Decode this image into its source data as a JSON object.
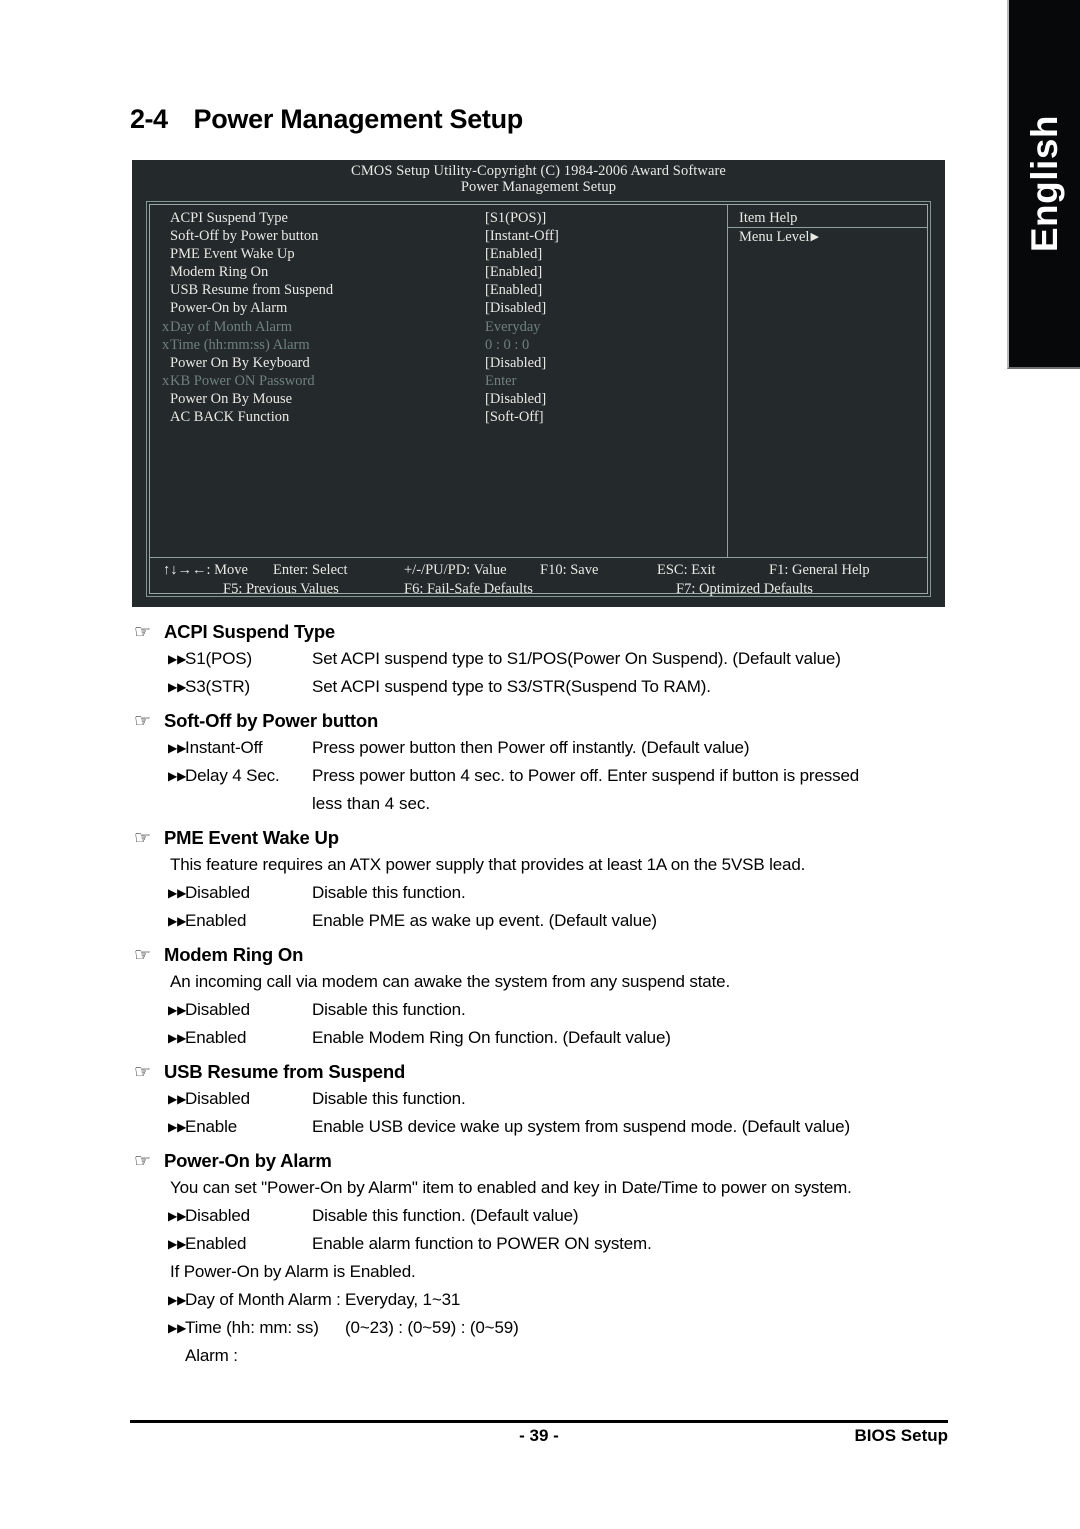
{
  "language_tab": {
    "label": "English"
  },
  "heading": {
    "number": "2-4",
    "title": "Power Management Setup"
  },
  "bios": {
    "title_line1": "CMOS Setup Utility-Copyright (C) 1984-2006 Award Software",
    "title_line2": "Power Management Setup",
    "items": [
      {
        "marker": "",
        "label": "ACPI Suspend Type",
        "value": "[S1(POS)]",
        "dim": false
      },
      {
        "marker": "",
        "label": "Soft-Off by Power button",
        "value": "[Instant-Off]",
        "dim": false
      },
      {
        "marker": "",
        "label": "PME Event Wake Up",
        "value": "[Enabled]",
        "dim": false
      },
      {
        "marker": "",
        "label": "Modem Ring On",
        "value": "[Enabled]",
        "dim": false
      },
      {
        "marker": "",
        "label": "USB Resume from Suspend",
        "value": "[Enabled]",
        "dim": false
      },
      {
        "marker": "",
        "label": "Power-On by Alarm",
        "value": "[Disabled]",
        "dim": false
      },
      {
        "marker": "x",
        "label": "Day of Month Alarm",
        "value": "Everyday",
        "dim": true
      },
      {
        "marker": "x",
        "label": "Time (hh:mm:ss) Alarm",
        "value": "0 : 0 : 0",
        "dim": true
      },
      {
        "marker": "",
        "label": "Power On By Keyboard",
        "value": "[Disabled]",
        "dim": false
      },
      {
        "marker": "x",
        "label": "KB Power ON Password",
        "value": "Enter",
        "dim": true
      },
      {
        "marker": "",
        "label": "Power On By Mouse",
        "value": "[Disabled]",
        "dim": false
      },
      {
        "marker": "",
        "label": "AC BACK Function",
        "value": "[Soft-Off]",
        "dim": false
      }
    ],
    "help": {
      "header": "Item Help",
      "menu_level": "Menu Level",
      "menu_level_arrow": "▶"
    },
    "legend": {
      "row1": [
        "↑↓→←: Move",
        "Enter: Select",
        "+/-/PU/PD: Value",
        "F10: Save",
        "ESC: Exit",
        "F1: General Help"
      ],
      "row2": [
        "F5: Previous Values",
        "F6: Fail-Safe Defaults",
        "F7: Optimized Defaults"
      ]
    }
  },
  "sections": [
    {
      "title": "ACPI Suspend Type",
      "para": "",
      "bullets": [
        {
          "term": "S1(POS)",
          "desc": "Set ACPI suspend type to S1/POS(Power On Suspend). (Default value)"
        },
        {
          "term": "S3(STR)",
          "desc": "Set ACPI suspend type to S3/STR(Suspend To RAM)."
        }
      ],
      "continuation": "",
      "para2": "",
      "bullets2": []
    },
    {
      "title": "Soft-Off by Power button",
      "para": "",
      "bullets": [
        {
          "term": "Instant-Off",
          "desc": "Press power button then Power off instantly. (Default value)"
        },
        {
          "term": "Delay 4 Sec.",
          "desc": "Press power button 4 sec. to Power off. Enter suspend if button is pressed"
        }
      ],
      "continuation": "less than 4 sec.",
      "para2": "",
      "bullets2": []
    },
    {
      "title": "PME Event Wake Up",
      "para": "This feature requires an ATX power supply that provides at least 1A on the 5VSB lead.",
      "bullets": [
        {
          "term": "Disabled",
          "desc": "Disable this function."
        },
        {
          "term": "Enabled",
          "desc": "Enable PME as wake up event. (Default value)"
        }
      ],
      "continuation": "",
      "para2": "",
      "bullets2": []
    },
    {
      "title": "Modem Ring On",
      "para": "An incoming call via modem can awake the system from any suspend state.",
      "bullets": [
        {
          "term": "Disabled",
          "desc": "Disable this function."
        },
        {
          "term": "Enabled",
          "desc": "Enable Modem Ring On function. (Default value)"
        }
      ],
      "continuation": "",
      "para2": "",
      "bullets2": []
    },
    {
      "title": "USB Resume from Suspend",
      "para": "",
      "bullets": [
        {
          "term": "Disabled",
          "desc": "Disable this function."
        },
        {
          "term": "Enable",
          "desc": "Enable USB device wake up system from suspend mode. (Default value)"
        }
      ],
      "continuation": "",
      "para2": "",
      "bullets2": []
    },
    {
      "title": "Power-On by Alarm",
      "para": "You can set \"Power-On by Alarm\" item to enabled and key in Date/Time to power on system.",
      "bullets": [
        {
          "term": "Disabled",
          "desc": "Disable this function. (Default value)"
        },
        {
          "term": "Enabled",
          "desc": "Enable alarm function to POWER ON system."
        }
      ],
      "continuation": "",
      "para2": "If Power-On by Alarm is Enabled.",
      "bullets2": [
        {
          "term": "Day of Month Alarm :",
          "desc": "Everyday, 1~31"
        },
        {
          "term": "Time (hh: mm: ss) Alarm :",
          "desc": "(0~23) : (0~59) : (0~59)"
        }
      ]
    }
  ],
  "footer": {
    "page_number": "- 39 -",
    "right_label": "BIOS Setup"
  },
  "glyphs": {
    "hand": "☞",
    "double_arrow": "▶▶"
  }
}
